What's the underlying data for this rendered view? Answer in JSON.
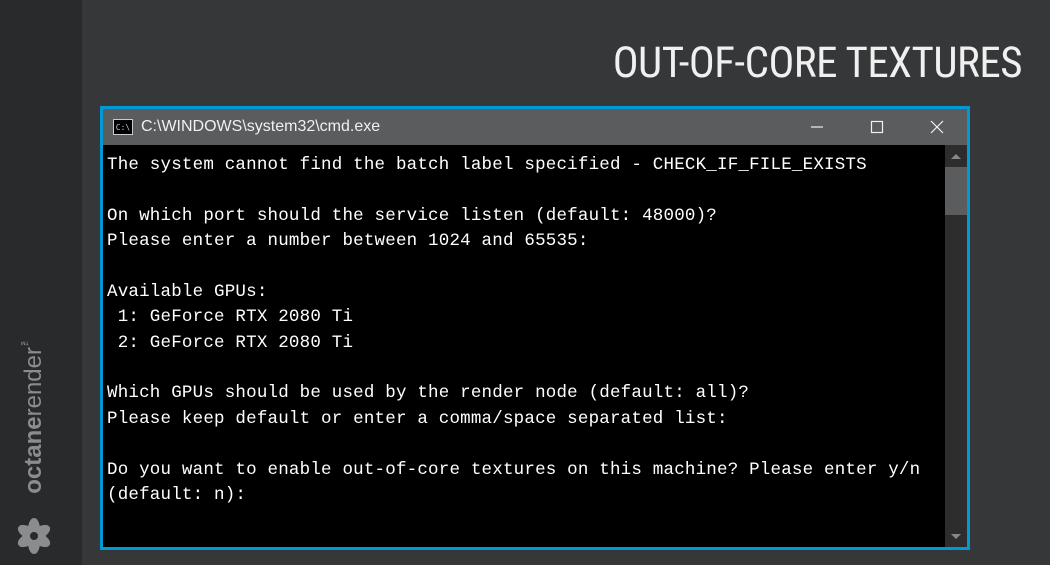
{
  "page": {
    "title": "OUT-OF-CORE TEXTURES"
  },
  "logo": {
    "brand_prefix": "octane",
    "brand_suffix": "render",
    "tm": "™"
  },
  "cmd": {
    "icon_label": "C:\\",
    "title": "C:\\WINDOWS\\system32\\cmd.exe",
    "lines": [
      "The system cannot find the batch label specified - CHECK_IF_FILE_EXISTS",
      "",
      "On which port should the service listen (default: 48000)?",
      "Please enter a number between 1024 and 65535:",
      "",
      "Available GPUs:",
      " 1: GeForce RTX 2080 Ti",
      " 2: GeForce RTX 2080 Ti",
      "",
      "Which GPUs should be used by the render node (default: all)?",
      "Please keep default or enter a comma/space separated list:",
      "",
      "Do you want to enable out-of-core textures on this machine? Please enter y/n (default: n):"
    ]
  }
}
